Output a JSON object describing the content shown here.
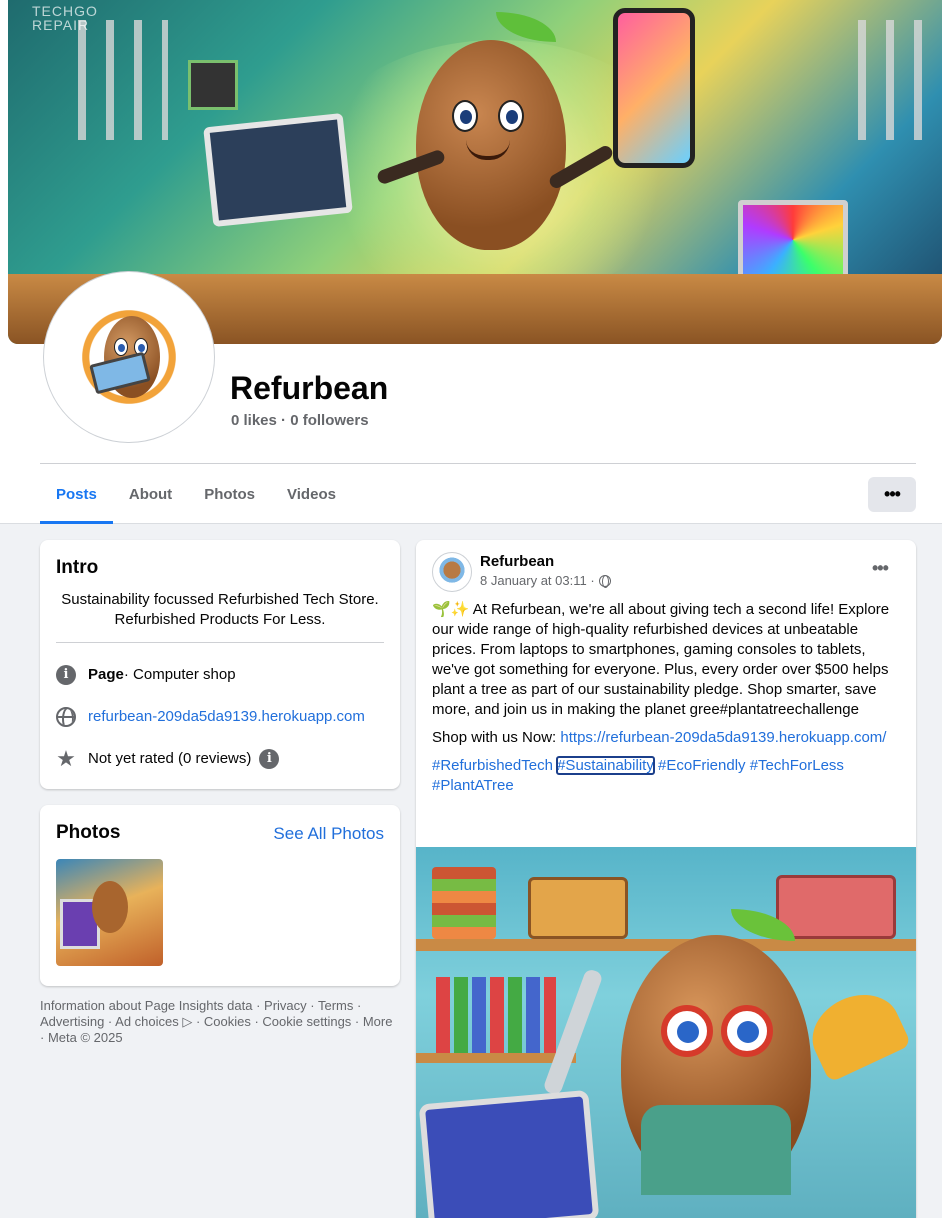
{
  "page": {
    "name": "Refurbean",
    "likes": "0 likes",
    "followers": "0 followers",
    "stat_separator": "·"
  },
  "tabs": [
    {
      "label": "Posts",
      "active": true
    },
    {
      "label": "About",
      "active": false
    },
    {
      "label": "Photos",
      "active": false
    },
    {
      "label": "Videos",
      "active": false
    }
  ],
  "more_button": "•••",
  "intro": {
    "title": "Intro",
    "bio": "Sustainability focussed Refurbished Tech Store. Refurbished Products For Less.",
    "category_label": "Page",
    "category_value": " · Computer shop",
    "website": "refurbean-209da5da9139.herokuapp.com",
    "rating": "Not yet rated (0 reviews)",
    "info_glyph": "i",
    "star_glyph": "★"
  },
  "photos": {
    "title": "Photos",
    "see_all": "See All Photos"
  },
  "footer": {
    "text": "Information about Page Insights data · Privacy · Terms · Advertising · Ad choices ▷ · Cookies · Cookie settings · More · Meta © 2025"
  },
  "post": {
    "author": "Refurbean",
    "timestamp": "8 January at 03:11 ·",
    "more": "•••",
    "text": "🌱✨ At Refurbean, we're all about giving tech a second life! Explore our wide range of high-quality refurbished devices at unbeatable prices. From laptops to smartphones, gaming consoles to tablets, we've got something for everyone. Plus, every order over $500 helps plant a tree as part of our sustainability pledge. Shop smarter, save more, and join us in making the planet gree#plantatreechallenge",
    "shop_prefix": "Shop with us Now: ",
    "shop_link": "https://refurbean-209da5da9139.herokuapp.com/",
    "hashtags": [
      "#RefurbishedTech",
      "#Sustainability",
      "#EcoFriendly",
      "#TechForLess",
      "#PlantATree"
    ]
  },
  "cover": {
    "watermark": "TECHGO\nREPAIR"
  },
  "colors": {
    "accent": "#1877f2",
    "link": "#216fdb",
    "background": "#f0f2f5",
    "secondary_text": "#65676b"
  }
}
